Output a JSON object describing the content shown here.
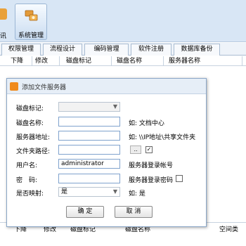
{
  "toolbar": {
    "prev_label": "讯",
    "system_label": "系统管理"
  },
  "tabs": [
    "权限管理",
    "流程设计",
    "编码管理",
    "软件注册",
    "数据库备份"
  ],
  "grid": {
    "headers": [
      "下降",
      "修改",
      "磁盘标记",
      "磁盘名称",
      "服务器名称"
    ]
  },
  "bottom_strip": {
    "cols": [
      "下降",
      "修改",
      "磁盘标记",
      "磁盘名称"
    ],
    "right_text": "空间类"
  },
  "dialog": {
    "title": "添加文件服务器",
    "disk_mark_label": "磁盘标记:",
    "disk_mark_value": "",
    "disk_name_label": "磁盘名称:",
    "disk_name_value": "",
    "disk_name_hint": "如: 文档中心",
    "server_addr_label": "服务器地址:",
    "server_addr_value": "",
    "server_addr_hint": "如: \\\\IP地址\\共享文件夹",
    "folder_path_label": "文件夹路径:",
    "folder_path_value": "",
    "browse_label": "..",
    "folder_checked": true,
    "username_label": "用户名:",
    "username_value": "administrator",
    "username_hint": "服务器登录帐号",
    "password_label": "密　码:",
    "password_value": "",
    "password_hint": "服务器登录密码",
    "password_checked": false,
    "mapped_label": "是否映射:",
    "mapped_value": "是",
    "mapped_hint": "如: 是",
    "ok_label": "确 定",
    "cancel_label": "取 消"
  },
  "colors": {
    "toolbar_bg": "#d8e6f5",
    "input_border": "#7fa2cd",
    "dialog_icon": "#f08a1c"
  }
}
